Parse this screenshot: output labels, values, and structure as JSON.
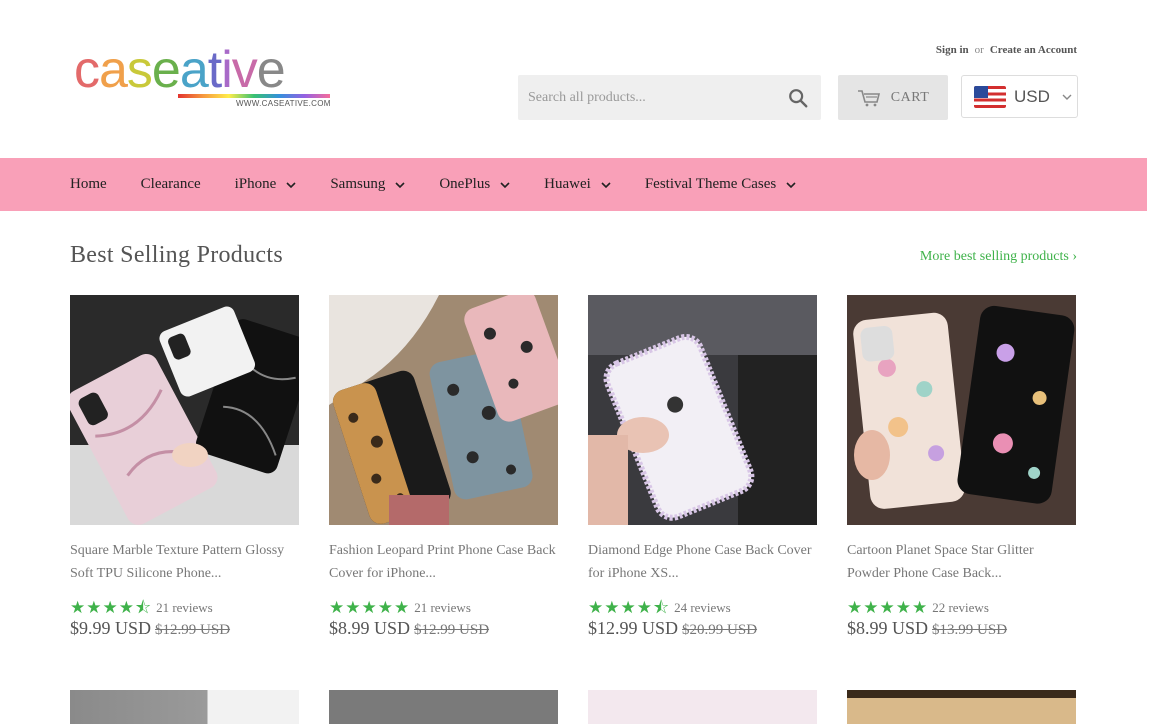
{
  "header": {
    "logo_text": "caseative",
    "logo_url": "WWW.CASEATIVE.COM",
    "sign_in": "Sign in",
    "or": "or",
    "create_account": "Create an Account",
    "search_placeholder": "Search all products...",
    "cart_label": "CART",
    "currency": "USD",
    "icons": [
      "search-icon",
      "cart-icon",
      "us-flag-icon",
      "chevron-down-icon"
    ]
  },
  "nav": {
    "items": [
      {
        "label": "Home",
        "dropdown": false
      },
      {
        "label": "Clearance",
        "dropdown": false
      },
      {
        "label": "iPhone",
        "dropdown": true
      },
      {
        "label": "Samsung",
        "dropdown": true
      },
      {
        "label": "OnePlus",
        "dropdown": true
      },
      {
        "label": "Huawei",
        "dropdown": true
      },
      {
        "label": "Festival Theme Cases",
        "dropdown": true
      }
    ],
    "background": "#f9a0b8"
  },
  "section": {
    "title": "Best Selling Products",
    "more_link": "More best selling products ›"
  },
  "products": [
    {
      "title": "Square Marble Texture Pattern Glossy Soft TPU Silicone Phone...",
      "rating": 4.5,
      "stars": "★★★★⯪",
      "reviews": "21 reviews",
      "price": "$9.99 USD",
      "compare_price": "$12.99 USD"
    },
    {
      "title": "Fashion Leopard Print Phone Case Back Cover for iPhone...",
      "rating": 5,
      "stars": "★★★★★",
      "reviews": "21 reviews",
      "price": "$8.99 USD",
      "compare_price": "$12.99 USD"
    },
    {
      "title": "Diamond Edge Phone Case Back Cover for iPhone XS...",
      "rating": 4.5,
      "stars": "★★★★⯪",
      "reviews": "24 reviews",
      "price": "$12.99 USD",
      "compare_price": "$20.99 USD"
    },
    {
      "title": "Cartoon Planet Space Star Glitter Powder Phone Case Back...",
      "rating": 5,
      "stars": "★★★★★",
      "reviews": "22 reviews",
      "price": "$8.99 USD",
      "compare_price": "$13.99 USD"
    }
  ],
  "colors": {
    "accent_green": "#3fb24a",
    "nav_pink": "#f9a0b8"
  }
}
